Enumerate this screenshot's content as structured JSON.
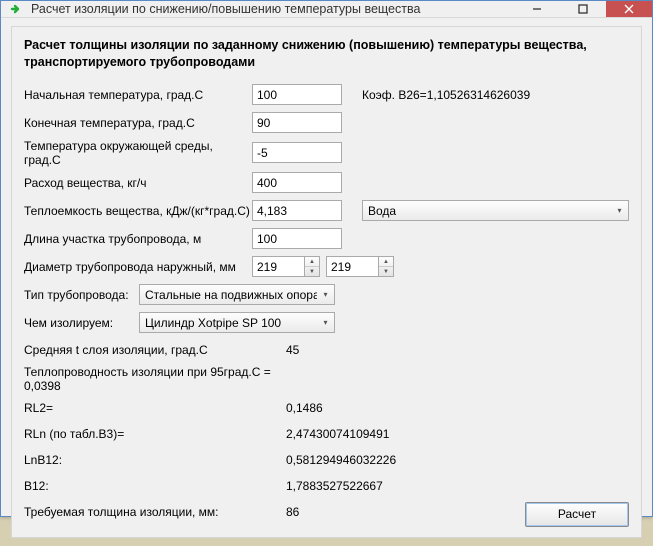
{
  "window": {
    "title": "Расчет изоляции по снижению/повышению температуры вещества"
  },
  "heading": "Расчет толщины изоляции по заданному снижению (повышению) температуры вещества, транспортируемого трубопроводами",
  "labels": {
    "t_start": "Начальная температура, град.С",
    "t_end": "Конечная температура, град.С",
    "t_env": "Температура окружающей среды, град.С",
    "flow": "Расход вещества, кг/ч",
    "heat_cap": "Теплоемкость вещества, кДж/(кг*град.С)",
    "pipe_len": "Длина участка трубопровода, м",
    "diam": "Диаметр трубопровода наружный, мм",
    "pipe_type": "Тип трубопровода:",
    "ins_mat": "Чем изолируем:",
    "layer_t": "Средняя t слоя изоляции, град.С",
    "lambda95": "Теплопроводность изоляции при 95град.С = 0,0398",
    "rl2": "RL2=",
    "rln": "RLn (по табл.B3)=",
    "lnb12": "LnB12:",
    "b12": "B12:",
    "thickness": "Требуемая толщина изоляции, мм:"
  },
  "values": {
    "t_start": "100",
    "t_end": "90",
    "t_env": "-5",
    "flow": "400",
    "heat_cap": "4,183",
    "pipe_len": "100",
    "diam_a": "219",
    "diam_b": "219"
  },
  "coef": "Коэф. В26=1,10526314626039",
  "dropdowns": {
    "medium": "Вода",
    "pipe_type": "Стальные на подвижных опорах",
    "ins_mat": "Цилиндр Xotpipe SP 100"
  },
  "results": {
    "layer_t": "45",
    "rl2": "0,1486",
    "rln": "2,47430074109491",
    "lnb12": "0,581294946032226",
    "b12": "1,7883527522667",
    "thickness": "86"
  },
  "buttons": {
    "calc": "Расчет"
  }
}
